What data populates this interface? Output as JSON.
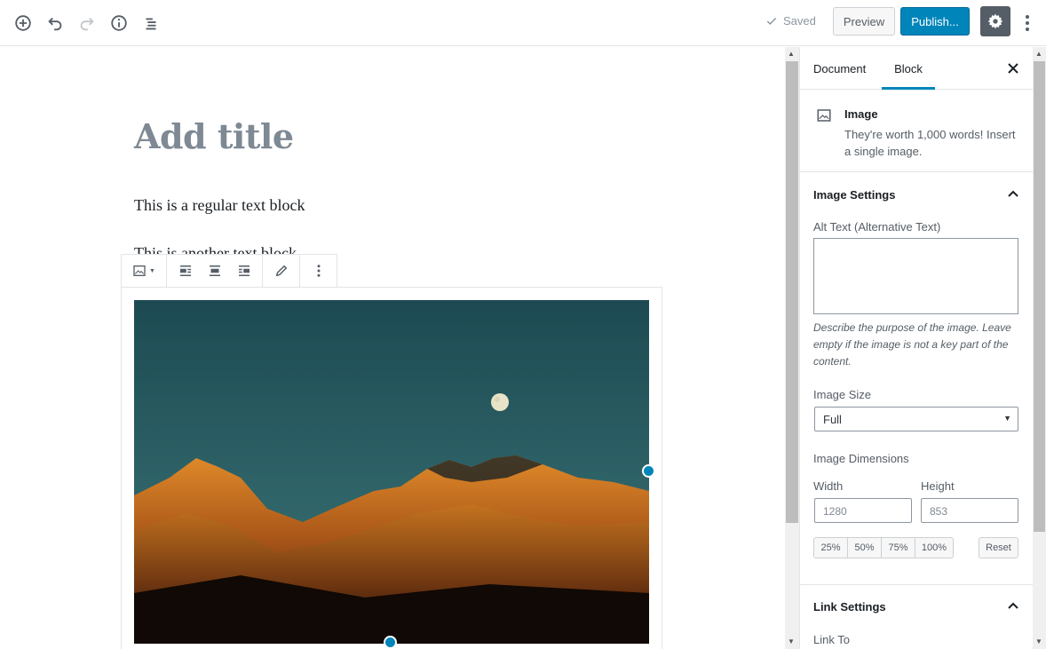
{
  "toolbar": {
    "add_block_icon": "plus-circle-icon",
    "undo_icon": "undo-icon",
    "redo_icon": "redo-icon",
    "info_icon": "info-icon",
    "outline_icon": "list-icon",
    "saved_label": "Saved",
    "preview_label": "Preview",
    "publish_label": "Publish...",
    "settings_icon": "gear-icon",
    "more_icon": "more-vertical-icon"
  },
  "editor": {
    "title_placeholder": "Add title",
    "paragraph_1": "This is a regular text block",
    "paragraph_2": "This is another text block"
  },
  "block_toolbar": {
    "type_icon": "image-icon",
    "align_left_icon": "align-left-icon",
    "align_center_icon": "align-center-icon",
    "align_right_icon": "align-right-icon",
    "edit_icon": "pencil-icon",
    "more_icon": "more-vertical-icon"
  },
  "sidebar": {
    "tabs": [
      {
        "label": "Document"
      },
      {
        "label": "Block"
      }
    ],
    "active_tab": "Block",
    "block": {
      "name": "Image",
      "description": "They're worth 1,000 words! Insert a single image."
    },
    "image_settings": {
      "heading": "Image Settings",
      "alt_label": "Alt Text (Alternative Text)",
      "alt_value": "",
      "alt_help": "Describe the purpose of the image. Leave empty if the image is not a key part of the content.",
      "size_label": "Image Size",
      "size_value": "Full",
      "dimensions_label": "Image Dimensions",
      "width_label": "Width",
      "width_value": "1280",
      "height_label": "Height",
      "height_value": "853",
      "percent_buttons": [
        "25%",
        "50%",
        "75%",
        "100%"
      ],
      "reset_label": "Reset"
    },
    "link_settings": {
      "heading": "Link Settings",
      "link_to_label": "Link To"
    }
  },
  "colors": {
    "accent": "#0085ba",
    "publish_border": "#006799",
    "settings_bg": "#555d66"
  }
}
